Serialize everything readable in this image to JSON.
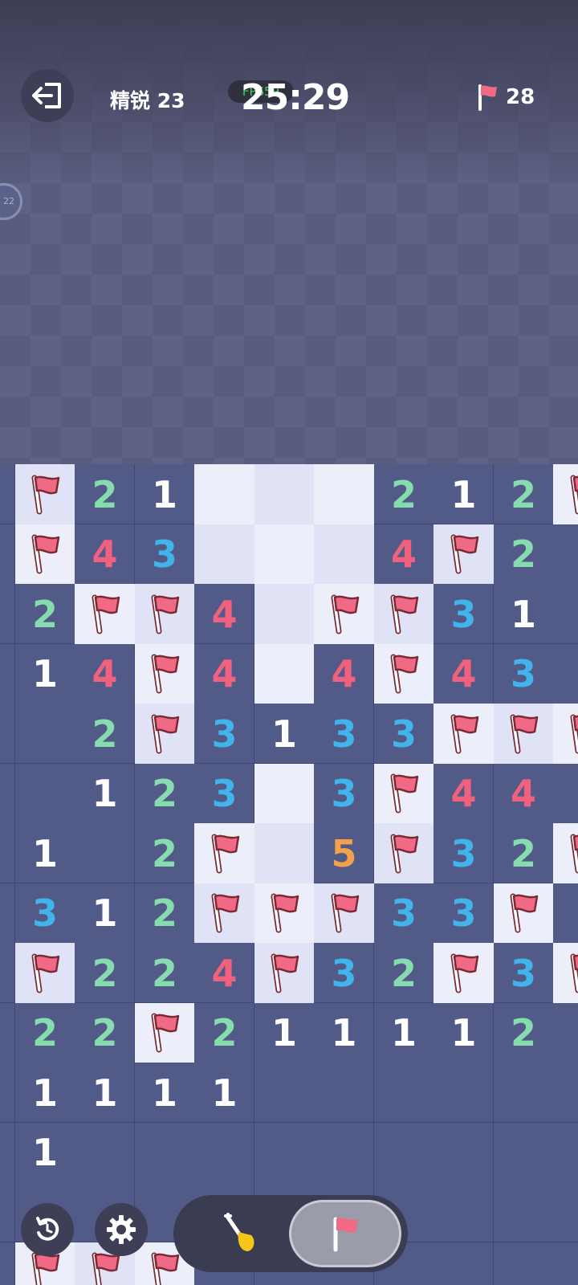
{
  "header": {
    "level_label": "精锐 23",
    "fps": "FPS59",
    "timer": "25:29",
    "flags_remaining": "28"
  },
  "side_badge": "22",
  "icons": {
    "exit": "exit-door-icon",
    "flag": "flag-icon",
    "restart": "restart-icon",
    "settings": "gear-icon",
    "dig": "shovel-icon"
  },
  "colors": {
    "closed_cell": "#525a88",
    "open_cell": "#eceef9",
    "num_1": "#ffffff",
    "num_2": "#86dcae",
    "num_3": "#42b4ec",
    "num_4": "#f0607f",
    "num_5": "#f5a04a",
    "flag": "#f06a86"
  },
  "board": {
    "legend": "F = flag, . = opened empty, # = closed/unrevealed, digits = number",
    "rows": [
      "#F21...212F",
      "#F43...4F2#",
      "#2FF4.FF31#",
      "#14F4.4F43#",
      "##2F3133FFF",
      "##123.3F44#",
      "#1#2F.5F32F",
      "#312FFF33F#",
      "#F224F32F3F",
      "#22F211112#",
      "#1111######",
      "#1#########",
      "###########",
      "#FFF#######"
    ]
  },
  "mode_toggle": {
    "selected": "flag"
  }
}
